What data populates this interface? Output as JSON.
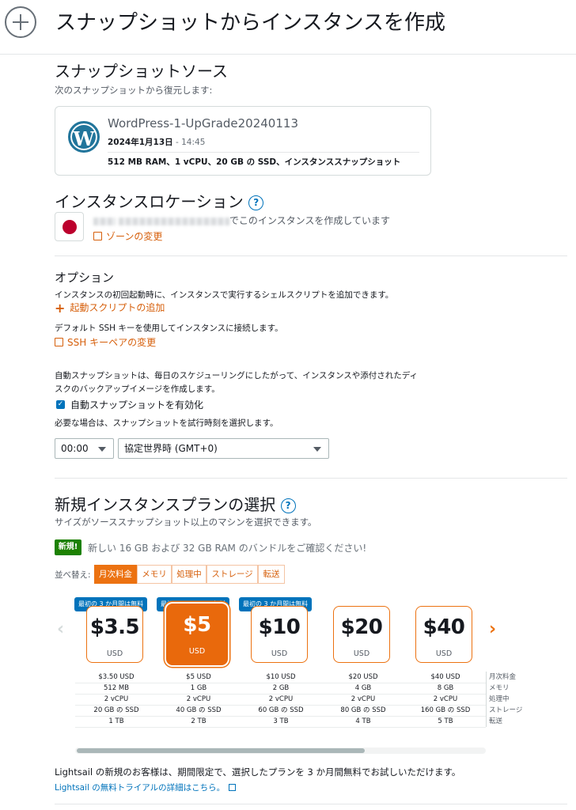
{
  "header": {
    "title": "スナップショットからインスタンスを作成"
  },
  "source": {
    "heading": "スナップショットソース",
    "desc": "次のスナップショットから復元します:",
    "snapshot_name": "WordPress-1-UpGrade20240113",
    "date": "2024年1月13日",
    "time": " - 14:45",
    "spec": "512 MB RAM、1 vCPU、20 GB の SSD、インスタンススナップショット"
  },
  "location": {
    "heading": "インスタンスロケーション",
    "help": "?",
    "text_suffix": "でこのインスタンスを作成しています",
    "change_zone": "ゾーンの変更"
  },
  "options": {
    "heading": "オプション",
    "script_desc": "インスタンスの初回起動時に、インスタンスで実行するシェルスクリプトを追加できます。",
    "add_script": "起動スクリプトの追加",
    "ssh_desc": "デフォルト SSH キーを使用してインスタンスに接続します。",
    "change_ssh": "SSH キーペアの変更",
    "auto_desc_1": "自動スナップショットは、毎日のスケジューリングにしたがって、インスタンスや添付されたディ",
    "auto_desc_2": "スクのバックアップイメージを作成します。",
    "auto_enable": "自動スナップショットを有効化",
    "time_desc": "必要な場合は、スナップショットを試行時刻を選択します。",
    "time_value": "00:00",
    "timezone_value": "協定世界時 (GMT+0)"
  },
  "plans": {
    "heading": "新規インスタンスプランの選択",
    "help": "?",
    "desc": "サイズがソーススナップショット以上のマシンを選択できます。",
    "new_badge": "新規!",
    "new_text": "新しい 16 GB および 32 GB RAM のバンドルをご確認ください!",
    "sort_label": "並べ替え:",
    "sort_tabs": [
      "月次料金",
      "メモリ",
      "処理中",
      "ストレージ",
      "転送"
    ],
    "free_badge": "最初の 3 か月間は無料",
    "currency": "USD",
    "cards": [
      {
        "price": "$3.5"
      },
      {
        "price": "$5"
      },
      {
        "price": "$10"
      },
      {
        "price": "$20"
      },
      {
        "price": "$40"
      }
    ],
    "spec_labels": [
      "月次料金",
      "メモリ",
      "処理中",
      "ストレージ",
      "転送"
    ],
    "specs": [
      [
        "$3.50 USD",
        "512 MB",
        "2 vCPU",
        "20 GB の SSD",
        "1 TB"
      ],
      [
        "$5 USD",
        "1 GB",
        "2 vCPU",
        "40 GB の SSD",
        "2 TB"
      ],
      [
        "$10 USD",
        "2 GB",
        "2 vCPU",
        "60 GB の SSD",
        "3 TB"
      ],
      [
        "$20 USD",
        "4 GB",
        "2 vCPU",
        "80 GB の SSD",
        "4 TB"
      ],
      [
        "$40 USD",
        "8 GB",
        "2 vCPU",
        "160 GB の SSD",
        "5 TB"
      ]
    ],
    "footer_text": "Lightsail の新規のお客様は、期間限定で、選択したプランを 3 か月間無料でお試しいただけます。",
    "footer_link": "Lightsail の無料トライアルの詳細はこちら。"
  },
  "colors": {
    "accent": "#ec7211",
    "link": "#0073bb",
    "new": "#1d8102"
  }
}
